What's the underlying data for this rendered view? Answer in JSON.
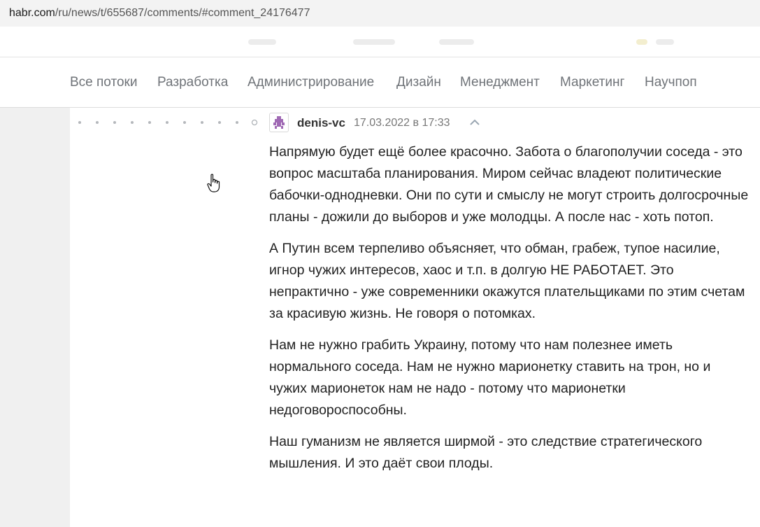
{
  "browser": {
    "url_host": "habr.com",
    "url_path": "/ru/news/t/655687/comments/#comment_24176477"
  },
  "nav": {
    "items": [
      {
        "label": "Все потоки"
      },
      {
        "label": "Разработка"
      },
      {
        "label": "Администрирование"
      },
      {
        "label": "Дизайн"
      },
      {
        "label": "Менеджмент"
      },
      {
        "label": "Маркетинг"
      },
      {
        "label": "Научпоп"
      }
    ]
  },
  "comment": {
    "author": "denis-vc",
    "date": "17.03.2022 в 17:33",
    "avatar_icon": "identicon-avatar-icon",
    "paragraphs": [
      "Напрямую будет ещё более красочно. Забота о благополучии соседа - это вопрос масштаба планирования. Миром сейчас владеют политические бабочки-однодневки. Они по сути и смыслу не могут строить долгосрочные планы - дожили до выборов и уже молодцы. А после нас - хоть потоп.",
      "А Путин всем терпеливо объясняет, что обман, грабеж, тупое насилие, игнор чужих интересов, хаос и т.п. в долгую НЕ РАБОТАЕТ. Это непрактично - уже современники окажутся плательщиками по этим счетам за красивую жизнь. Не говоря о потомках.",
      "Нам не нужно грабить Украину, потому что нам полезнее иметь нормального соседа. Нам не нужно марионетку ставить на трон, но и чужих марионеток нам не надо - потому что марионетки недоговороспособны.",
      "Наш гуманизм не является ширмой - это следствие стратегического мышления. И это даёт свои плоды."
    ]
  },
  "colors": {
    "nav_text": "#6f7378",
    "avatar_accent": "#a06ab4",
    "thread_dot": "#b5b8bc"
  }
}
